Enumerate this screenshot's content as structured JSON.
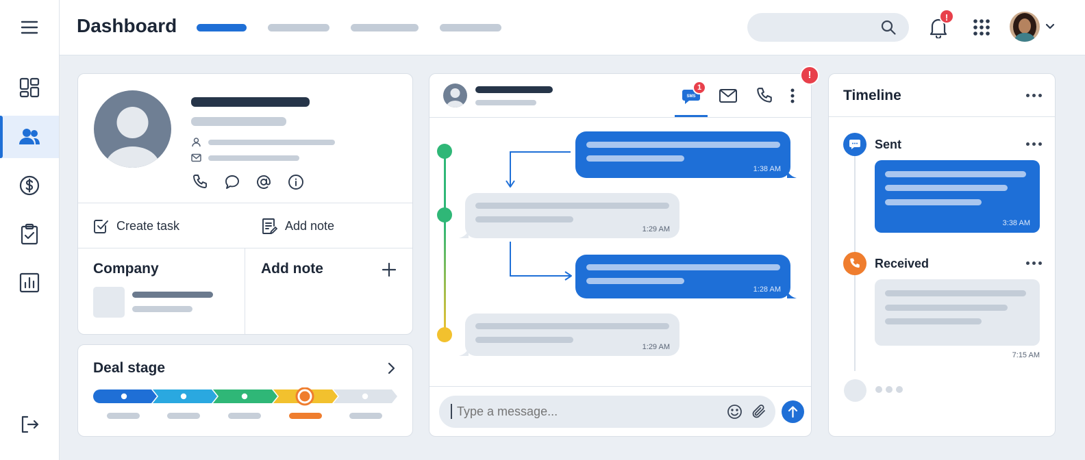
{
  "header": {
    "title": "Dashboard",
    "notification_count": "!",
    "accent": "#1f6fd6"
  },
  "rail": {
    "items": [
      "menu-icon",
      "dashboard-icon",
      "contacts-icon",
      "dollar-icon",
      "clipboard-check-icon",
      "bar-chart-icon",
      "logout-icon"
    ],
    "active": "contacts-icon"
  },
  "contact": {
    "actions": {
      "create_task": "Create task",
      "add_note": "Add note"
    },
    "company_heading": "Company",
    "add_note_heading": "Add note"
  },
  "deal_stage": {
    "heading": "Deal stage",
    "stages": 5,
    "current_stage": 4,
    "colors": [
      "#1f6fd6",
      "#2aa8e0",
      "#2fb777",
      "#f2c12e",
      "#dde3ea"
    ]
  },
  "conversation": {
    "alert_badge": "!",
    "sms_badge": "1",
    "sms_label": "SMS",
    "messages": [
      {
        "direction": "out",
        "time": "1:38 AM"
      },
      {
        "direction": "in",
        "time": "1:29 AM"
      },
      {
        "direction": "out",
        "time": "1:28 AM"
      },
      {
        "direction": "in",
        "time": "1:29 AM"
      }
    ],
    "composer_placeholder": "Type a message..."
  },
  "timeline": {
    "heading": "Timeline",
    "events": [
      {
        "label": "Sent",
        "time": "3:38 AM"
      },
      {
        "label": "Received",
        "time": "7:15 AM"
      }
    ]
  }
}
